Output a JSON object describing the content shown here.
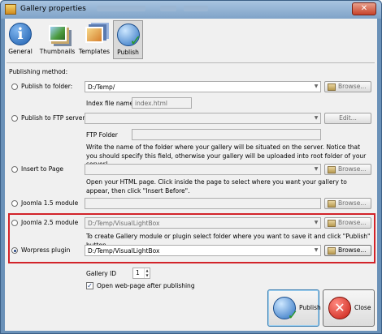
{
  "window": {
    "title": "Gallery properties",
    "close_glyph": "✕"
  },
  "toolbar": {
    "items": [
      {
        "label": "General",
        "icon": "info-icon"
      },
      {
        "label": "Thumbnails",
        "icon": "thumbnails-icon"
      },
      {
        "label": "Templates",
        "icon": "templates-icon"
      },
      {
        "label": "Publish",
        "icon": "publish-globe-icon",
        "active": true
      }
    ]
  },
  "publishing": {
    "heading": "Publishing method:",
    "folder": {
      "label": "Publish to folder:",
      "value": "D:/Temp/",
      "browse": "Browse...",
      "index_label": "Index file name",
      "index_value": "index.html"
    },
    "ftp": {
      "label": "Publish to FTP server",
      "value": "",
      "edit": "Edit...",
      "folder_label": "FTP Folder",
      "folder_value": "",
      "note": "Write the name of the folder where your gallery will be situated on the server. Notice that you should specify this field, otherwise your gallery will be uploaded into root folder of your server!"
    },
    "page": {
      "label": "Insert to Page",
      "value": "",
      "browse": "Browse...",
      "note": "Open your HTML page. Click inside the page to select where you want your gallery to appear, then click \"Insert Before\"."
    },
    "joomla15": {
      "label": "Joomla 1.5 module",
      "value": "",
      "browse": "Browse..."
    },
    "joomla25": {
      "label": "Joomla 2.5 module",
      "value": "D:/Temp/VisualLightBox",
      "browse": "Browse...",
      "note": "To create Gallery module or plugin select folder where you want to save it and click \"Publish\" button."
    },
    "wordpress": {
      "label": "Worpress plugin",
      "value": "D:/Temp/VisualLightBox",
      "browse": "Browse...",
      "selected": true
    },
    "gallery_id_label": "Gallery ID",
    "gallery_id_value": "1",
    "open_after_label": "Open web-page after publishing",
    "open_after_checked": true
  },
  "actions": {
    "publish": "Publish",
    "close": "Close"
  },
  "colors": {
    "highlight": "#d2232a",
    "titlebar": "#7fa3c8"
  }
}
